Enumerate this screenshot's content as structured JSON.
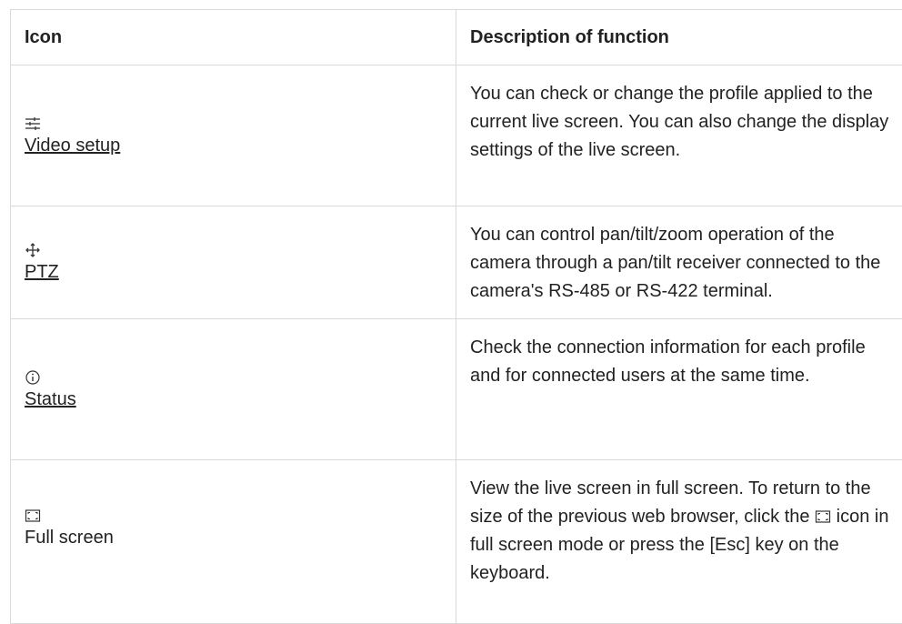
{
  "table": {
    "header": {
      "icon": "Icon",
      "description": "Description of function"
    },
    "rows": [
      {
        "icon_name": "sliders-icon",
        "label": "Video setup",
        "description": "You can check or change the profile applied to the current live screen. You can also change the display settings of the live screen."
      },
      {
        "icon_name": "move-arrows-icon",
        "label": "PTZ",
        "description": "You can control pan/tilt/zoom operation of the camera through a pan/tilt receiver connected to the camera's RS-485 or RS-422 terminal."
      },
      {
        "icon_name": "info-circle-icon",
        "label": "Status",
        "description": "Check the connection information for each profile and for connected users at the same time."
      },
      {
        "icon_name": "fullscreen-icon",
        "label": "Full screen",
        "description_before": "View the live screen in full screen. To return to the size of the previous web browser, click the",
        "description_after": "icon in full screen mode or press the [Esc] key on the keyboard."
      }
    ]
  }
}
